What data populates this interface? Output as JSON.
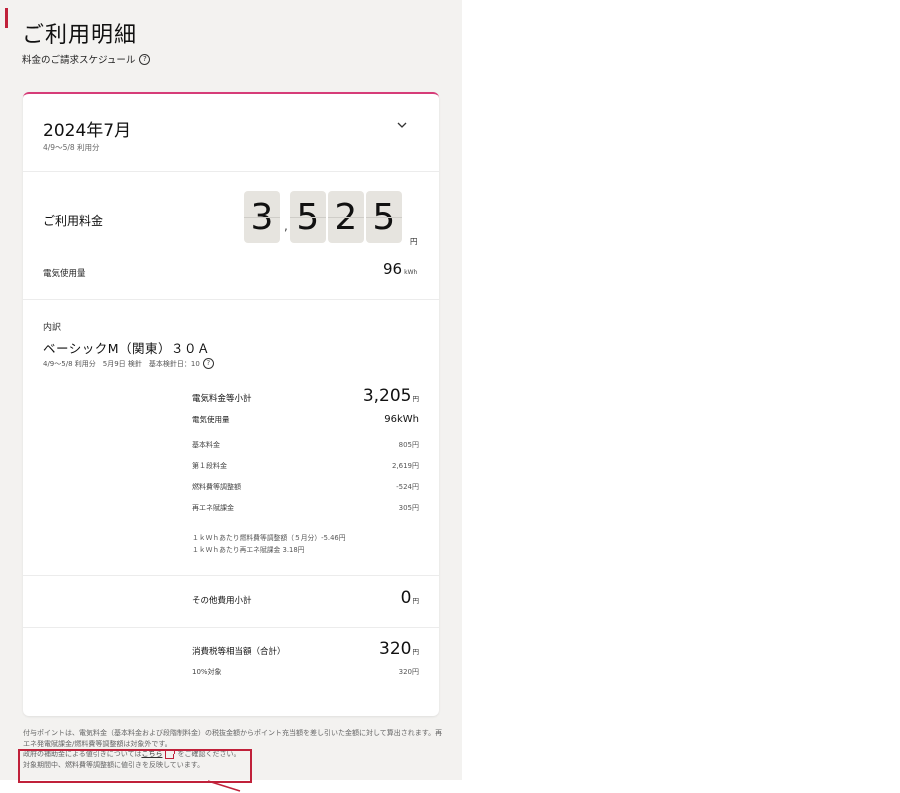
{
  "page": {
    "title": "ご利用明細",
    "schedule_link": "料金のご請求スケジュール",
    "help_glyph": "?"
  },
  "billing": {
    "month": "2024年7月",
    "range": "4/9〜5/8 利用分",
    "usage_label": "ご利用料金",
    "amount_digits": [
      "3",
      "5",
      "2",
      "5"
    ],
    "amount_separator": ",",
    "amount_unit": "円",
    "kwh_label": "電気使用量",
    "kwh_value": "96",
    "kwh_unit": "kWh"
  },
  "breakdown": {
    "label": "内訳",
    "plan_name": "ベーシックM（関東）３０Ａ",
    "plan_meta": "4/9〜5/8 利用分　5月9日 検針　基本検針日：10",
    "electric_subtotal": {
      "label": "電気料金等小計",
      "value": "3,205",
      "unit": "円"
    },
    "electric_usage": {
      "label": "電気使用量",
      "value": "96kWh"
    },
    "items": [
      {
        "label": "基本料金",
        "value": "805円"
      },
      {
        "label": "第１段料金",
        "value": "2,619円"
      },
      {
        "label": "燃料費等調整額",
        "value": "-524円"
      },
      {
        "label": "再エネ賦課金",
        "value": "305円"
      }
    ],
    "notes": [
      "１ｋＷｈあたり燃料費等調整額（５月分）-5.46円",
      "１ｋＷｈあたり再エネ賦課金 3.18円"
    ],
    "other_subtotal": {
      "label": "その他費用小計",
      "value": "0",
      "unit": "円"
    },
    "tax_total": {
      "label": "消費税等相当額（合計）",
      "value": "320",
      "unit": "円"
    },
    "tax_item": {
      "label": "10%対象",
      "value": "320円"
    }
  },
  "footer": {
    "line1": "付与ポイントは、電気料金（基本料金および段階制料金）の税抜金額からポイント充当額を差し引いた金額に対して算出されます。再エネ発電賦課金/燃料費等調整額は対象外です。",
    "line2_prefix": "政府の補助金による値引きについては",
    "line2_link": "こちら",
    "line2_suffix": "をご確認ください。",
    "line3": "対象期間中、燃料費等調整額に値引きを反映しています。"
  },
  "colors": {
    "accent": "#c0213a",
    "card_top": "#d63c78",
    "panel_bg": "#f3f2f0"
  }
}
